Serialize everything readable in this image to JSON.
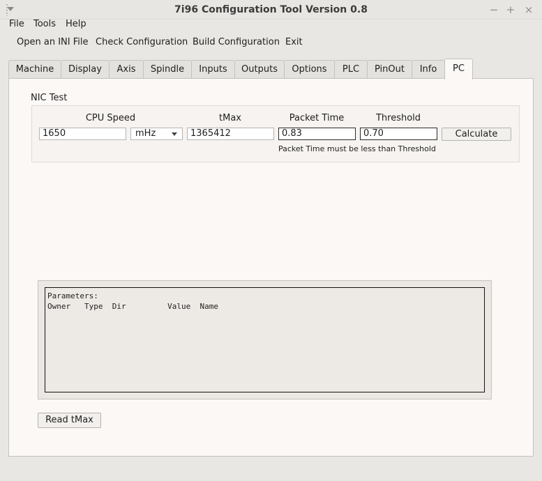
{
  "window": {
    "title": "7i96 Configuration Tool Version 0.8",
    "controls": {
      "minimize": "−",
      "maximize": "+",
      "close": "×"
    }
  },
  "menubar": [
    "File",
    "Tools",
    "Help"
  ],
  "toolbar": {
    "open_ini": "Open an INI File",
    "check_config": "Check Configuration",
    "build_config": "Build Configuration",
    "exit": "Exit"
  },
  "tabs": [
    "Machine",
    "Display",
    "Axis",
    "Spindle",
    "Inputs",
    "Outputs",
    "Options",
    "PLC",
    "PinOut",
    "Info",
    "PC"
  ],
  "active_tab": "PC",
  "nic_test": {
    "legend": "NIC Test",
    "labels": {
      "cpu_speed": "CPU Speed",
      "tmax": "tMax",
      "packet_time": "Packet Time",
      "threshold": "Threshold"
    },
    "cpu_speed_value": "1650",
    "cpu_unit": "mHz",
    "tmax_value": "1365412",
    "packet_time_value": "0.83",
    "threshold_value": "0.70",
    "calculate_label": "Calculate",
    "hint": "Packet Time must be less than Threshold"
  },
  "parameters": {
    "header": "Parameters:",
    "columns": "Owner   Type  Dir         Value  Name"
  },
  "read_tmax_label": "Read tMax"
}
